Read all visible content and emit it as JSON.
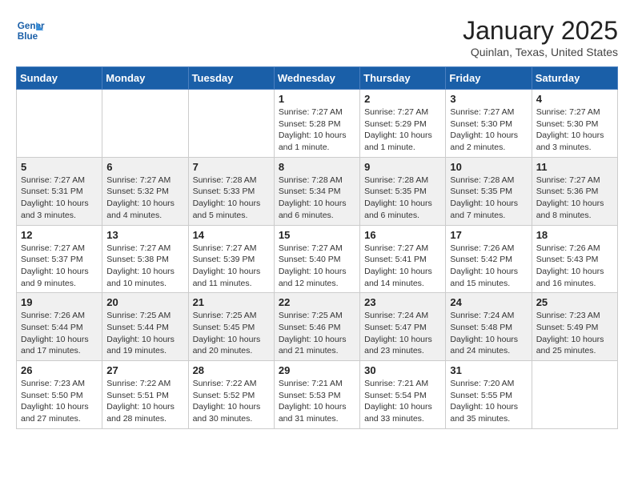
{
  "header": {
    "logo_line1": "General",
    "logo_line2": "Blue",
    "month_title": "January 2025",
    "location": "Quinlan, Texas, United States"
  },
  "days_of_week": [
    "Sunday",
    "Monday",
    "Tuesday",
    "Wednesday",
    "Thursday",
    "Friday",
    "Saturday"
  ],
  "weeks": [
    [
      {
        "day": "",
        "info": ""
      },
      {
        "day": "",
        "info": ""
      },
      {
        "day": "",
        "info": ""
      },
      {
        "day": "1",
        "info": "Sunrise: 7:27 AM\nSunset: 5:28 PM\nDaylight: 10 hours\nand 1 minute."
      },
      {
        "day": "2",
        "info": "Sunrise: 7:27 AM\nSunset: 5:29 PM\nDaylight: 10 hours\nand 1 minute."
      },
      {
        "day": "3",
        "info": "Sunrise: 7:27 AM\nSunset: 5:30 PM\nDaylight: 10 hours\nand 2 minutes."
      },
      {
        "day": "4",
        "info": "Sunrise: 7:27 AM\nSunset: 5:30 PM\nDaylight: 10 hours\nand 3 minutes."
      }
    ],
    [
      {
        "day": "5",
        "info": "Sunrise: 7:27 AM\nSunset: 5:31 PM\nDaylight: 10 hours\nand 3 minutes."
      },
      {
        "day": "6",
        "info": "Sunrise: 7:27 AM\nSunset: 5:32 PM\nDaylight: 10 hours\nand 4 minutes."
      },
      {
        "day": "7",
        "info": "Sunrise: 7:28 AM\nSunset: 5:33 PM\nDaylight: 10 hours\nand 5 minutes."
      },
      {
        "day": "8",
        "info": "Sunrise: 7:28 AM\nSunset: 5:34 PM\nDaylight: 10 hours\nand 6 minutes."
      },
      {
        "day": "9",
        "info": "Sunrise: 7:28 AM\nSunset: 5:35 PM\nDaylight: 10 hours\nand 6 minutes."
      },
      {
        "day": "10",
        "info": "Sunrise: 7:28 AM\nSunset: 5:35 PM\nDaylight: 10 hours\nand 7 minutes."
      },
      {
        "day": "11",
        "info": "Sunrise: 7:27 AM\nSunset: 5:36 PM\nDaylight: 10 hours\nand 8 minutes."
      }
    ],
    [
      {
        "day": "12",
        "info": "Sunrise: 7:27 AM\nSunset: 5:37 PM\nDaylight: 10 hours\nand 9 minutes."
      },
      {
        "day": "13",
        "info": "Sunrise: 7:27 AM\nSunset: 5:38 PM\nDaylight: 10 hours\nand 10 minutes."
      },
      {
        "day": "14",
        "info": "Sunrise: 7:27 AM\nSunset: 5:39 PM\nDaylight: 10 hours\nand 11 minutes."
      },
      {
        "day": "15",
        "info": "Sunrise: 7:27 AM\nSunset: 5:40 PM\nDaylight: 10 hours\nand 12 minutes."
      },
      {
        "day": "16",
        "info": "Sunrise: 7:27 AM\nSunset: 5:41 PM\nDaylight: 10 hours\nand 14 minutes."
      },
      {
        "day": "17",
        "info": "Sunrise: 7:26 AM\nSunset: 5:42 PM\nDaylight: 10 hours\nand 15 minutes."
      },
      {
        "day": "18",
        "info": "Sunrise: 7:26 AM\nSunset: 5:43 PM\nDaylight: 10 hours\nand 16 minutes."
      }
    ],
    [
      {
        "day": "19",
        "info": "Sunrise: 7:26 AM\nSunset: 5:44 PM\nDaylight: 10 hours\nand 17 minutes."
      },
      {
        "day": "20",
        "info": "Sunrise: 7:25 AM\nSunset: 5:44 PM\nDaylight: 10 hours\nand 19 minutes."
      },
      {
        "day": "21",
        "info": "Sunrise: 7:25 AM\nSunset: 5:45 PM\nDaylight: 10 hours\nand 20 minutes."
      },
      {
        "day": "22",
        "info": "Sunrise: 7:25 AM\nSunset: 5:46 PM\nDaylight: 10 hours\nand 21 minutes."
      },
      {
        "day": "23",
        "info": "Sunrise: 7:24 AM\nSunset: 5:47 PM\nDaylight: 10 hours\nand 23 minutes."
      },
      {
        "day": "24",
        "info": "Sunrise: 7:24 AM\nSunset: 5:48 PM\nDaylight: 10 hours\nand 24 minutes."
      },
      {
        "day": "25",
        "info": "Sunrise: 7:23 AM\nSunset: 5:49 PM\nDaylight: 10 hours\nand 25 minutes."
      }
    ],
    [
      {
        "day": "26",
        "info": "Sunrise: 7:23 AM\nSunset: 5:50 PM\nDaylight: 10 hours\nand 27 minutes."
      },
      {
        "day": "27",
        "info": "Sunrise: 7:22 AM\nSunset: 5:51 PM\nDaylight: 10 hours\nand 28 minutes."
      },
      {
        "day": "28",
        "info": "Sunrise: 7:22 AM\nSunset: 5:52 PM\nDaylight: 10 hours\nand 30 minutes."
      },
      {
        "day": "29",
        "info": "Sunrise: 7:21 AM\nSunset: 5:53 PM\nDaylight: 10 hours\nand 31 minutes."
      },
      {
        "day": "30",
        "info": "Sunrise: 7:21 AM\nSunset: 5:54 PM\nDaylight: 10 hours\nand 33 minutes."
      },
      {
        "day": "31",
        "info": "Sunrise: 7:20 AM\nSunset: 5:55 PM\nDaylight: 10 hours\nand 35 minutes."
      },
      {
        "day": "",
        "info": ""
      }
    ]
  ]
}
